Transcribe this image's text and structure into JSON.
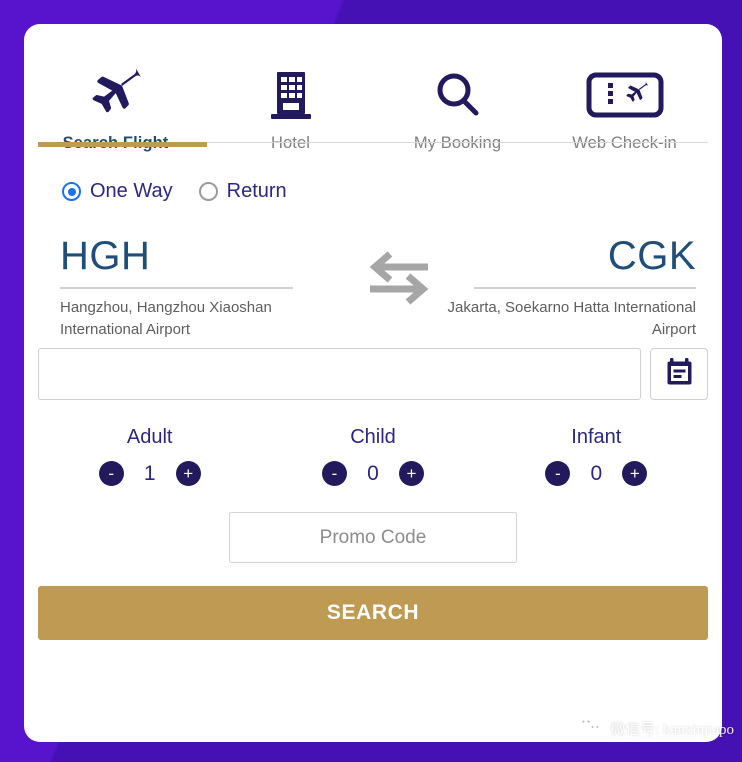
{
  "theme": {
    "background_purple": "#4e12b8",
    "accent_gold": "#bf9a53",
    "navy": "#231a5e",
    "steel_blue": "#1f4e79",
    "indigo_text": "#2b2784",
    "radio_blue": "#1a73e8"
  },
  "tabs": [
    {
      "label": "Search Flight",
      "icon": "airplane-icon",
      "active": true
    },
    {
      "label": "Hotel",
      "icon": "building-icon",
      "active": false
    },
    {
      "label": "My Booking",
      "icon": "search-icon",
      "active": false
    },
    {
      "label": "Web Check-in",
      "icon": "boarding-pass-icon",
      "active": false
    }
  ],
  "trip_type": {
    "options": [
      {
        "label": "One Way",
        "selected": true
      },
      {
        "label": "Return",
        "selected": false
      }
    ]
  },
  "route": {
    "origin": {
      "code": "HGH",
      "name": "Hangzhou, Hangzhou Xiaoshan International Airport"
    },
    "destination": {
      "code": "CGK",
      "name": "Jakarta, Soekarno Hatta International Airport"
    },
    "swap_icon": "swap-arrows-icon"
  },
  "date": {
    "value": "",
    "placeholder": "",
    "calendar_icon": "calendar-icon"
  },
  "passengers": [
    {
      "label": "Adult",
      "value": "1",
      "minus": "-",
      "plus": "+"
    },
    {
      "label": "Child",
      "value": "0",
      "minus": "-",
      "plus": "+"
    },
    {
      "label": "Infant",
      "value": "0",
      "minus": "-",
      "plus": "+"
    }
  ],
  "promo": {
    "value": "",
    "placeholder": "Promo Code"
  },
  "search": {
    "label": "SEARCH"
  },
  "watermark": {
    "text": "微信号: kanxinjiapo",
    "icon": "wechat-icon"
  }
}
